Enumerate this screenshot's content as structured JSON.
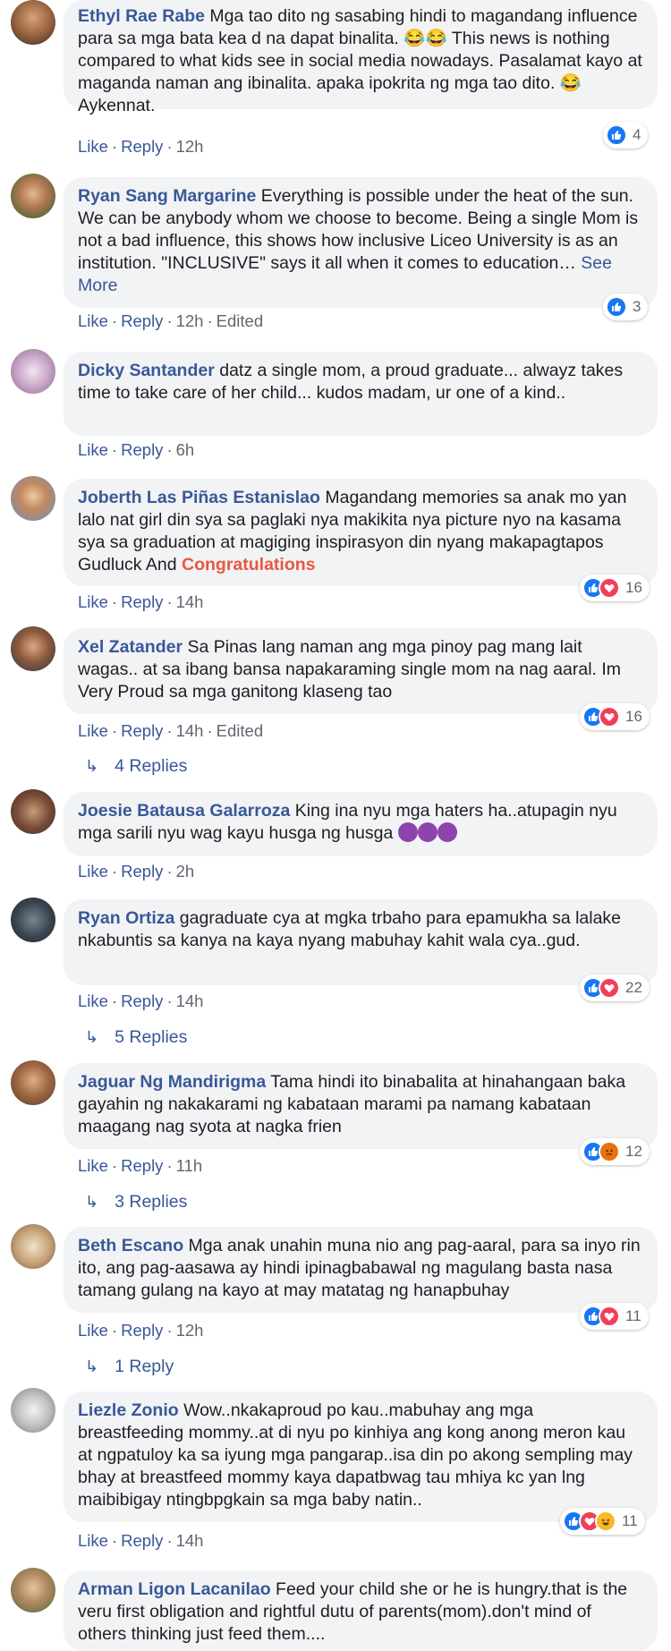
{
  "comments": [
    {
      "author": "Ethyl Rae Rabe",
      "text": " Mga tao dito ng sasabing hindi to magandang influence para sa mga bata kea d na dapat binalita. 😂😂 This news is nothing compared to what kids see in social media nowadays. Pasalamat kayo at maganda naman ang ibinalita. apaka ipokrita ng mga tao dito. 😂 Aykennat.",
      "like": "Like",
      "reply": "Reply",
      "time": "12h",
      "reaction_count": "4"
    },
    {
      "author": "Ryan Sang Margarine",
      "text": " Everything is possible under the heat of the sun. We can be anybody whom we choose to become. Being a single Mom is not a bad influence, this shows how inclusive Liceo University is as an institution. \"INCLUSIVE\" says it all when it comes to education… ",
      "see_more": "See More",
      "like": "Like",
      "reply": "Reply",
      "time": "12h",
      "edited": "Edited",
      "reaction_count": "3"
    },
    {
      "author": "Dicky Santander",
      "text": " datz a single mom, a proud graduate... alwayz takes time to take care of her child... kudos madam, ur one of a kind..",
      "like": "Like",
      "reply": "Reply",
      "time": "6h"
    },
    {
      "author": "Joberth Las Piñas Estanislao",
      "text": " Magandang memories sa anak mo yan lalo nat girl din sya sa paglaki nya makikita nya picture nyo na kasama sya sa graduation at magiging inspirasyon din nyang makapagtapos Gudluck And ",
      "highlight": "Congratulations",
      "like": "Like",
      "reply": "Reply",
      "time": "14h",
      "reaction_count": "16"
    },
    {
      "author": "Xel Zatander",
      "text": " Sa Pinas lang naman ang mga pinoy pag mang lait wagas.. at sa ibang bansa napakaraming single mom na nag aaral. Im Very Proud sa mga ganitong klaseng tao",
      "like": "Like",
      "reply": "Reply",
      "time": "14h",
      "edited": "Edited",
      "reaction_count": "16",
      "replies": "4 Replies"
    },
    {
      "author": "Joesie Batausa Galarroza",
      "text": " King ina nyu mga haters ha..atupagin nyu mga sarili nyu wag kayu husga ng husga",
      "like": "Like",
      "reply": "Reply",
      "time": "2h"
    },
    {
      "author": "Ryan Ortiza",
      "text": " gagraduate cya at mgka trbaho para epamukha sa lalake nkabuntis sa kanya na kaya nyang mabuhay kahit wala cya..gud.",
      "like": "Like",
      "reply": "Reply",
      "time": "14h",
      "reaction_count": "22",
      "replies": "5 Replies"
    },
    {
      "author": "Jaguar Ng Mandirigma",
      "text": " Tama hindi ito binabalita at hinahangaan baka gayahin ng nakakarami ng kabataan marami pa namang kabataan maagang nag syota at nagka frien",
      "like": "Like",
      "reply": "Reply",
      "time": "11h",
      "reaction_count": "12",
      "replies": "3 Replies"
    },
    {
      "author": "Beth Escano",
      "text": " Mga anak unahin muna nio ang pag-aaral, para sa inyo rin ito, ang pag-aasawa ay hindi ipinagbabawal ng magulang basta nasa tamang gulang na kayo at may matatag ng hanapbuhay",
      "like": "Like",
      "reply": "Reply",
      "time": "12h",
      "reaction_count": "11",
      "replies": "1 Reply"
    },
    {
      "author": "Liezle Zonio",
      "text": " Wow..nkakaproud po kau..mabuhay ang mga breastfeeding mommy..at di nyu po kinhiya ang kong anong meron kau at ngpatuloy ka sa iyung mga pangarap..isa din po akong sempling may bhay at breastfeed mommy kaya dapatbwag tau mhiya kc yan lng maibibigay ntingbpgkain sa mga baby natin..",
      "like": "Like",
      "reply": "Reply",
      "time": "14h",
      "reaction_count": "11"
    },
    {
      "author": "Arman Ligon Lacanilao",
      "text": " Feed your child she or he is hungry.that is the veru first obligation and rightful dutu of parents(mom).don't mind of others thinking just feed them...."
    }
  ],
  "colors": {
    "link": "#385898",
    "bubble": "#f2f3f5",
    "like": "#1877f2",
    "love": "#f33e58",
    "haha": "#f7b928",
    "angry": "#e9710f",
    "highlight": "#e9573f"
  },
  "icons": [
    "like-icon",
    "love-icon",
    "haha-icon",
    "angry-icon",
    "reply-arrow-icon",
    "laughing-emoji",
    "devil-emoji"
  ]
}
